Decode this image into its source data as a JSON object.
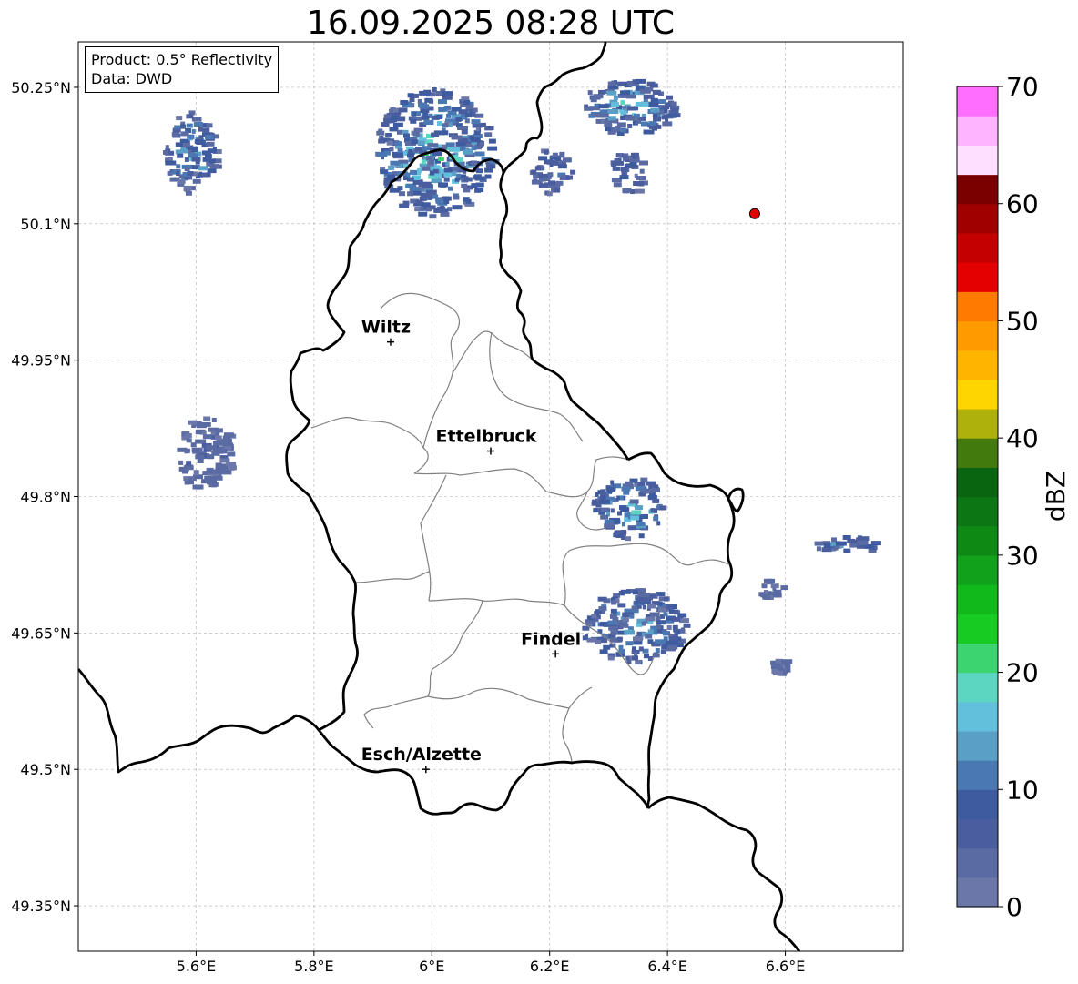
{
  "title": "16.09.2025 08:28 UTC",
  "info_box": {
    "product_line": "Product: 0.5° Reflectivity",
    "data_line": "Data: DWD"
  },
  "map": {
    "lon_range": [
      5.4,
      6.8
    ],
    "lat_range": [
      49.3,
      50.3
    ],
    "lon_ticks": [
      {
        "value": 5.6,
        "label": "5.6°E"
      },
      {
        "value": 5.8,
        "label": "5.8°E"
      },
      {
        "value": 6.0,
        "label": "6°E"
      },
      {
        "value": 6.2,
        "label": "6.2°E"
      },
      {
        "value": 6.4,
        "label": "6.4°E"
      },
      {
        "value": 6.6,
        "label": "6.6°E"
      }
    ],
    "lat_ticks": [
      {
        "value": 50.25,
        "label": "50.25°N"
      },
      {
        "value": 50.1,
        "label": "50.1°N"
      },
      {
        "value": 49.95,
        "label": "49.95°N"
      },
      {
        "value": 49.8,
        "label": "49.8°N"
      },
      {
        "value": 49.65,
        "label": "49.65°N"
      },
      {
        "value": 49.5,
        "label": "49.5°N"
      },
      {
        "value": 49.35,
        "label": "49.35°N"
      }
    ],
    "gridlines": true,
    "cities": [
      {
        "name": "Wiltz",
        "lon": 5.93,
        "lat": 49.97
      },
      {
        "name": "Ettelbruck",
        "lon": 6.1,
        "lat": 49.85
      },
      {
        "name": "Findel",
        "lon": 6.21,
        "lat": 49.627
      },
      {
        "name": "Esch/Alzette",
        "lon": 5.99,
        "lat": 49.5
      }
    ],
    "radar_site": {
      "lon": 6.548,
      "lat": 50.111,
      "color": "#e00000"
    },
    "echo_clusters": [
      {
        "lon": 5.585,
        "lat": 50.18,
        "rlon": 0.045,
        "rlat": 0.045,
        "max_dbz": 20
      },
      {
        "lon": 5.61,
        "lat": 49.85,
        "rlon": 0.05,
        "rlat": 0.04,
        "max_dbz": 8
      },
      {
        "lon": 6.0,
        "lat": 50.18,
        "rlon": 0.1,
        "rlat": 0.07,
        "max_dbz": 24
      },
      {
        "lon": 6.2,
        "lat": 50.16,
        "rlon": 0.035,
        "rlat": 0.025,
        "max_dbz": 14
      },
      {
        "lon": 6.33,
        "lat": 50.16,
        "rlon": 0.03,
        "rlat": 0.025,
        "max_dbz": 12
      },
      {
        "lon": 6.33,
        "lat": 50.23,
        "rlon": 0.08,
        "rlat": 0.03,
        "max_dbz": 22
      },
      {
        "lon": 6.33,
        "lat": 49.79,
        "rlon": 0.06,
        "rlat": 0.035,
        "max_dbz": 22
      },
      {
        "lon": 6.34,
        "lat": 49.66,
        "rlon": 0.09,
        "rlat": 0.04,
        "max_dbz": 20
      },
      {
        "lon": 6.7,
        "lat": 49.75,
        "rlon": 0.055,
        "rlat": 0.01,
        "max_dbz": 18
      },
      {
        "lon": 6.57,
        "lat": 49.7,
        "rlon": 0.025,
        "rlat": 0.01,
        "max_dbz": 5
      },
      {
        "lon": 6.59,
        "lat": 49.615,
        "rlon": 0.02,
        "rlat": 0.008,
        "max_dbz": 5
      }
    ]
  },
  "colorbar": {
    "label": "dBZ",
    "min": 0,
    "max": 70,
    "step": 2.5,
    "ticks": [
      0,
      10,
      20,
      30,
      40,
      50,
      60,
      70
    ],
    "colors": [
      "#6b77a8",
      "#5a6aa3",
      "#4a5d9e",
      "#3e5ba0",
      "#4a78b2",
      "#5a9fc5",
      "#63c0dc",
      "#5cd6c0",
      "#3cd470",
      "#18cb22",
      "#12b91b",
      "#11a11b",
      "#0e8a14",
      "#0c7614",
      "#0a6511",
      "#437a0e",
      "#aeb10c",
      "#ffd500",
      "#ffb400",
      "#ff9a00",
      "#ff7a00",
      "#e40000",
      "#c40000",
      "#a10000",
      "#7a0000",
      "#ffdfff",
      "#ffb4ff",
      "#ff6eff",
      "#ee32ee"
    ]
  }
}
